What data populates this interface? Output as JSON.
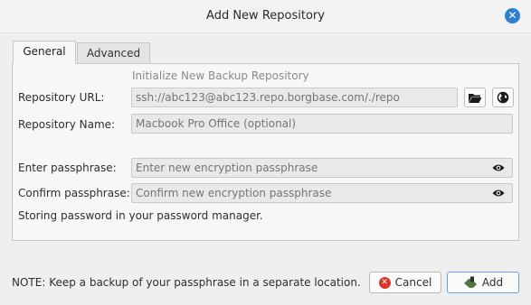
{
  "window": {
    "title": "Add New Repository",
    "close_icon": "close-icon"
  },
  "tabs": [
    {
      "label": "General",
      "active": true
    },
    {
      "label": "Advanced",
      "active": false
    }
  ],
  "form": {
    "heading": "Initialize New Backup Repository",
    "repo_url": {
      "label": "Repository URL:",
      "placeholder": "ssh://abc123@abc123.repo.borgbase.com/./repo",
      "value": ""
    },
    "repo_name": {
      "label": "Repository Name:",
      "placeholder": "Macbook Pro Office (optional)",
      "value": ""
    },
    "passphrase": {
      "label": "Enter passphrase:",
      "placeholder": "Enter new encryption passphrase",
      "value": ""
    },
    "confirm_passphrase": {
      "label": "Confirm passphrase:",
      "placeholder": "Confirm new encryption passphrase",
      "value": ""
    },
    "storage_note": "Storing password in your password manager."
  },
  "footer": {
    "note": "NOTE: Keep a backup of your passphrase in a separate location.",
    "cancel_label": "Cancel",
    "add_label": "Add"
  },
  "colors": {
    "accent": "#2f7fd1",
    "cancel_icon": "#d9352b",
    "add_icon": "#4b7a3a"
  }
}
